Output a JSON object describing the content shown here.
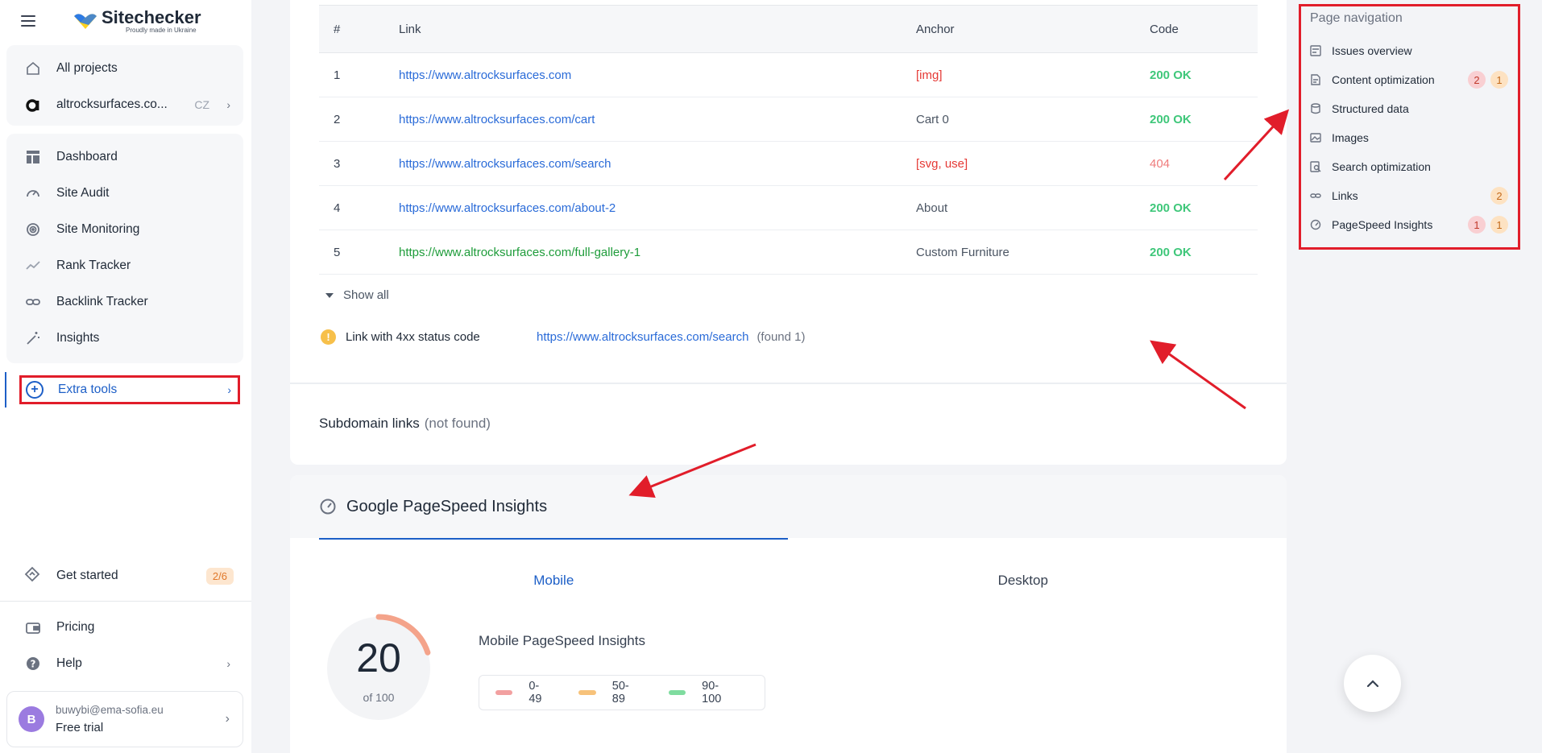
{
  "brand": {
    "name": "Sitechecker",
    "tagline": "Proudly made in Ukraine"
  },
  "sidebar": {
    "top": [
      {
        "label": "All projects",
        "icon": "home-icon"
      },
      {
        "label": "altrocksurfaces.co...",
        "lang": "CZ",
        "icon": "site-favicon-icon"
      }
    ],
    "tools": [
      {
        "label": "Dashboard",
        "icon": "dashboard-icon"
      },
      {
        "label": "Site Audit",
        "icon": "gauge-icon"
      },
      {
        "label": "Site Monitoring",
        "icon": "radar-icon"
      },
      {
        "label": "Rank Tracker",
        "icon": "trend-icon"
      },
      {
        "label": "Backlink Tracker",
        "icon": "link-icon"
      },
      {
        "label": "Insights",
        "icon": "magic-wand-icon"
      }
    ],
    "extra_tools": "Extra tools",
    "get_started": {
      "label": "Get started",
      "badge": "2/6"
    },
    "bottom": [
      {
        "label": "Pricing",
        "icon": "wallet-icon"
      },
      {
        "label": "Help",
        "icon": "help-icon"
      }
    ],
    "user": {
      "initial": "B",
      "email": "buwybi@ema-sofia.eu",
      "plan": "Free trial"
    }
  },
  "links_table": {
    "headers": [
      "#",
      "Link",
      "Anchor",
      "Code"
    ],
    "rows": [
      {
        "n": "1",
        "link": "https://www.altrocksurfaces.com",
        "anchor": "[img]",
        "code": "200 OK"
      },
      {
        "n": "2",
        "link": "https://www.altrocksurfaces.com/cart",
        "anchor": "Cart 0",
        "code": "200 OK"
      },
      {
        "n": "3",
        "link": "https://www.altrocksurfaces.com/search",
        "anchor": "[svg, use]",
        "code": "404"
      },
      {
        "n": "4",
        "link": "https://www.altrocksurfaces.com/about-2",
        "anchor": "About",
        "code": "200 OK"
      },
      {
        "n": "5",
        "link": "https://www.altrocksurfaces.com/full-gallery-1",
        "anchor": "Custom Furniture",
        "code": "200 OK"
      }
    ],
    "show_all": "Show all",
    "warning": {
      "label": "Link with 4xx status code",
      "link": "https://www.altrocksurfaces.com/search",
      "found": "(found 1)"
    },
    "subdomain": {
      "label": "Subdomain links",
      "status": "(not found)"
    }
  },
  "pagespeed": {
    "title": "Google PageSpeed Insights",
    "tabs": [
      "Mobile",
      "Desktop"
    ],
    "score": "20",
    "score_of": "of 100",
    "score_fraction": 0.2,
    "subtitle": "Mobile PageSpeed Insights",
    "legend": [
      {
        "label": "0-49",
        "color": "#f2a0a0"
      },
      {
        "label": "50-89",
        "color": "#f7c27a"
      },
      {
        "label": "90-100",
        "color": "#7fdc9f"
      }
    ]
  },
  "page_navigation": {
    "title": "Page navigation",
    "items": [
      {
        "label": "Issues overview",
        "badges": []
      },
      {
        "label": "Content optimization",
        "badges": [
          {
            "v": "2",
            "t": "red"
          },
          {
            "v": "1",
            "t": "orange"
          }
        ]
      },
      {
        "label": "Structured data",
        "badges": []
      },
      {
        "label": "Images",
        "badges": []
      },
      {
        "label": "Search optimization",
        "badges": []
      },
      {
        "label": "Links",
        "badges": [
          {
            "v": "2",
            "t": "orange"
          }
        ]
      },
      {
        "label": "PageSpeed Insights",
        "badges": [
          {
            "v": "1",
            "t": "red"
          },
          {
            "v": "1",
            "t": "orange"
          }
        ]
      }
    ]
  },
  "colors": {
    "accent": "#1d5fc7",
    "highlight": "#e11d2a",
    "ok": "#3fc77a",
    "error": "#e53935"
  }
}
